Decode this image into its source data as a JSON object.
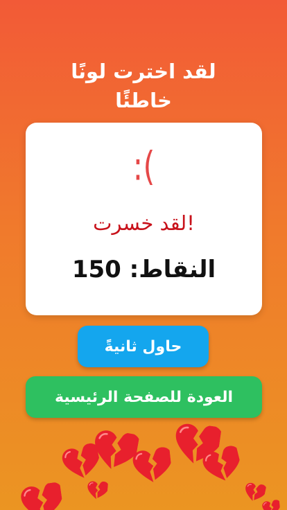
{
  "screen": {
    "title_line1": "لقد اخترت لونًا",
    "title_line2": "خاطئًا"
  },
  "result_card": {
    "face": ":(",
    "message": "لقد خسرت!",
    "score_text": "النقاط: 150",
    "score_value": 150
  },
  "buttons": {
    "retry_label": "حاول ثانيةً",
    "home_label": "العودة للصفحة الرئيسية"
  },
  "decoration": {
    "icon": "broken-heart-icon",
    "color": "#e8202d"
  },
  "colors": {
    "background_top": "#f25a37",
    "background_bottom": "#eb9522",
    "retry_button": "#14a6ee",
    "home_button": "#2ec060",
    "sad_face": "#e54848",
    "lost_text": "#c8121b"
  }
}
